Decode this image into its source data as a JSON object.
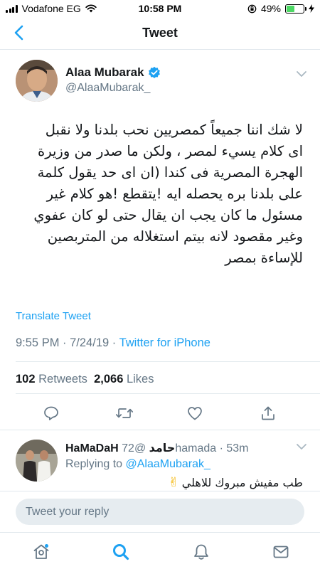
{
  "status_bar": {
    "carrier": "Vodafone EG",
    "time": "10:58 PM",
    "battery_percent": "49%",
    "battery_level": 0.49,
    "icons": [
      "signal-bars-icon",
      "wifi-icon",
      "orientation-lock-icon",
      "battery-icon",
      "charging-bolt-icon"
    ]
  },
  "nav": {
    "title": "Tweet",
    "back_icon": "chevron-left-icon"
  },
  "tweet": {
    "author_name": "Alaa Mubarak",
    "verified": true,
    "handle": "@AlaaMubarak_",
    "text_lines": [
      "لا شك اننا جميعاً كمصريين  نحب بلدنا ولا نقبل",
      "اى كلام  يسيء لمصر ، ولكن ما صدر من وزيرة",
      "الهجرة المصرية فى كندا  (ان اى حد يقول كلمة",
      "على بلدنا  بره يحصله ايه !يتقطع !هو كلام غير",
      "مسئول  ما كان يجب ان يقال حتى لو كان عفوي",
      "وغير  مقصود لانه بيتم استغلاله من المتربصين",
      "للإساءة بمصر"
    ],
    "translate_label": "Translate Tweet",
    "time": "9:55 PM",
    "separator": " · ",
    "date": "7/24/19",
    "source_separator": " · ",
    "source": "Twitter for iPhone",
    "retweets_count": "102",
    "retweets_label": "Retweets",
    "likes_count": "2,066",
    "likes_label": "Likes"
  },
  "actions": [
    "reply-icon",
    "retweet-icon",
    "like-icon",
    "share-icon"
  ],
  "reply": {
    "display_name": "HaMaDaH حامد",
    "handle": "@72hamada",
    "separator": " · ",
    "time": "53m",
    "replying_prefix": "Replying to ",
    "replying_to": "@AlaaMubarak_",
    "text": "طب مفيش مبروك للاهلي",
    "emoji": "✌"
  },
  "composer": {
    "placeholder": "Tweet your reply"
  },
  "tabs": [
    "home-icon",
    "search-icon",
    "notifications-icon",
    "messages-icon"
  ],
  "colors": {
    "accent": "#1da1f2",
    "muted": "#657786",
    "text": "#14171a",
    "battery": "#4cd964"
  }
}
